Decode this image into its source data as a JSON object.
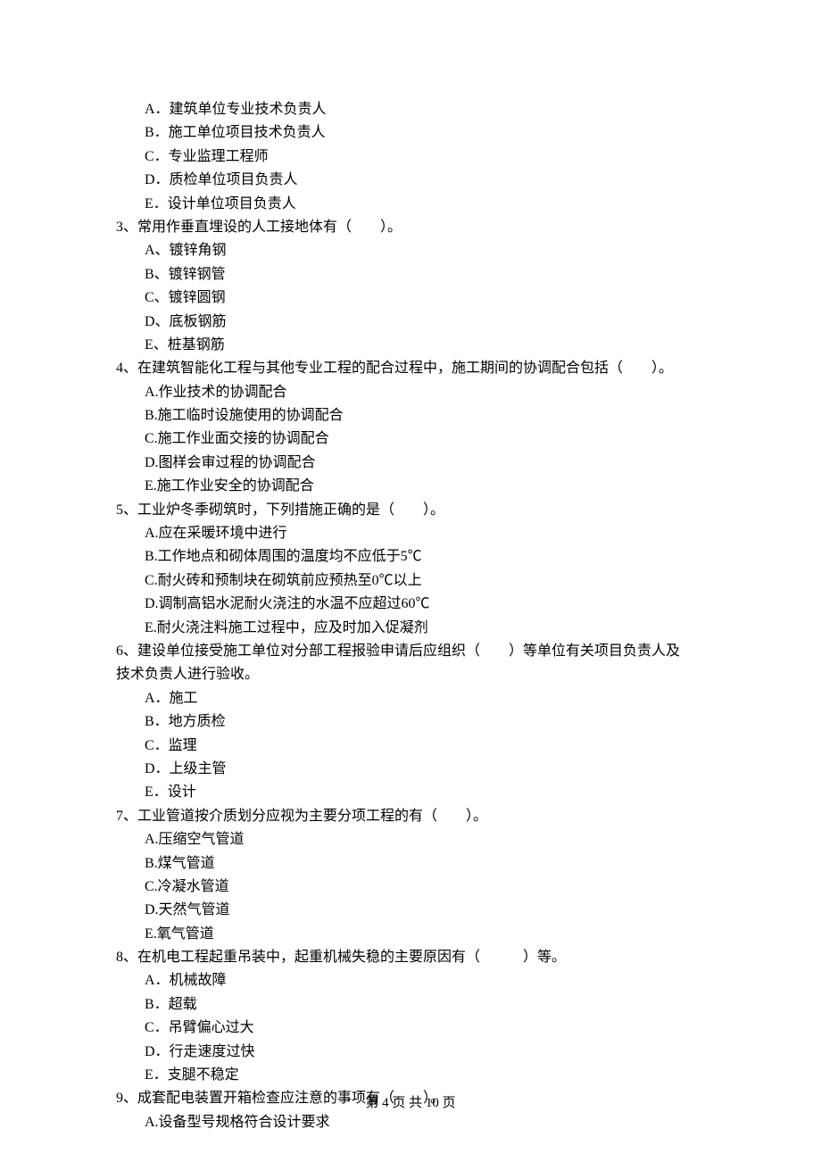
{
  "footer": {
    "text": "第 4 页 共 10 页"
  },
  "prevOptions": [
    "A．建筑单位专业技术负责人",
    "B．施工单位项目技术负责人",
    "C．专业监理工程师",
    "D．质检单位项目负责人",
    "E．设计单位项目负责人"
  ],
  "questions": [
    {
      "stem": "3、常用作垂直埋设的人工接地体有（　　）。",
      "options": [
        "A、镀锌角钢",
        "B、镀锌钢管",
        "C、镀锌圆钢",
        "D、底板钢筋",
        "E、桩基钢筋"
      ]
    },
    {
      "stem": "4、在建筑智能化工程与其他专业工程的配合过程中，施工期间的协调配合包括（　　）。",
      "options": [
        "A.作业技术的协调配合",
        "B.施工临时设施使用的协调配合",
        "C.施工作业面交接的协调配合",
        "D.图样会审过程的协调配合",
        "E.施工作业安全的协调配合"
      ]
    },
    {
      "stem": "5、工业炉冬季砌筑时，下列措施正确的是（　　）。",
      "options": [
        "A.应在采暖环境中进行",
        "B.工作地点和砌体周围的温度均不应低于5℃",
        "C.耐火砖和预制块在砌筑前应预热至0℃以上",
        "D.调制高铝水泥耐火浇注的水温不应超过60℃",
        "E.耐火浇注料施工过程中，应及时加入促凝剂"
      ]
    },
    {
      "stem": "6、建设单位接受施工单位对分部工程报验申请后应组织（　　）等单位有关项目负责人及",
      "continue": "技术负责人进行验收。",
      "options": [
        "A．施工",
        "B．地方质检",
        "C．监理",
        "D．上级主管",
        "E．设计"
      ]
    },
    {
      "stem": "7、工业管道按介质划分应视为主要分项工程的有（　　）。",
      "options": [
        "A.压缩空气管道",
        "B.煤气管道",
        "C.冷凝水管道",
        "D.天然气管道",
        "E.氧气管道"
      ]
    },
    {
      "stem": "8、在机电工程起重吊装中，起重机械失稳的主要原因有（　　　）等。",
      "options": [
        "A．机械故障",
        "B．超载",
        "C．吊臂偏心过大",
        "D．行走速度过快",
        "E．支腿不稳定"
      ]
    },
    {
      "stem": "9、成套配电装置开箱检查应注意的事项有（　　）。",
      "options": [
        "A.设备型号规格符合设计要求"
      ]
    }
  ]
}
